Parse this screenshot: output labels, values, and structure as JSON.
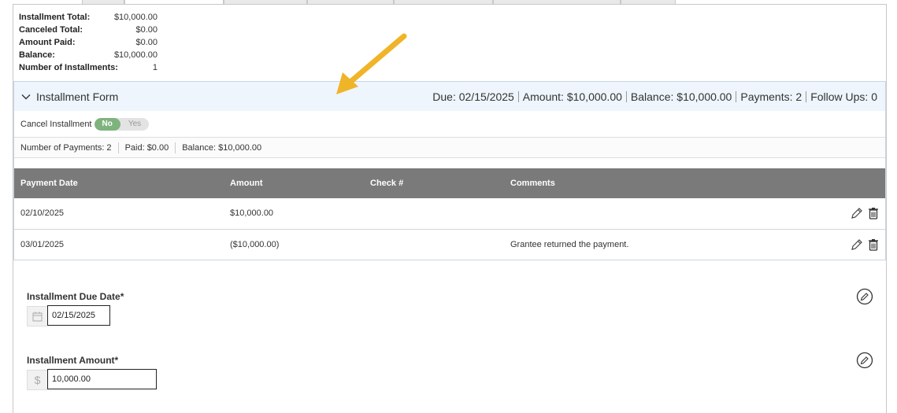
{
  "summary": {
    "rows": [
      {
        "label": "Installment Total:",
        "value": "$10,000.00"
      },
      {
        "label": "Canceled Total:",
        "value": "$0.00"
      },
      {
        "label": "Amount Paid:",
        "value": "$0.00"
      },
      {
        "label": "Balance:",
        "value": "$10,000.00"
      },
      {
        "label": "Number of Installments:",
        "value": "1"
      }
    ]
  },
  "panel": {
    "title": "Installment Form",
    "due": "Due: 02/15/2025",
    "amount": "Amount: $10,000.00",
    "balance": "Balance: $10,000.00",
    "payments": "Payments: 2",
    "followups": "Follow Ups: 0"
  },
  "cancel": {
    "label": "Cancel Installment",
    "no": "No",
    "yes": "Yes"
  },
  "counts": {
    "payments": "Number of Payments: 2",
    "paid": "Paid: $0.00",
    "balance": "Balance: $10,000.00"
  },
  "table": {
    "headers": [
      "Payment Date",
      "Amount",
      "Check #",
      "Comments"
    ],
    "rows": [
      {
        "date": "02/10/2025",
        "amount": "$10,000.00",
        "check": "",
        "comment": ""
      },
      {
        "date": "03/01/2025",
        "amount": "($10,000.00)",
        "check": "",
        "comment": "Grantee returned the payment."
      }
    ]
  },
  "form": {
    "due_label": "Installment Due Date*",
    "due_value": "02/15/2025",
    "amount_label": "Installment Amount*",
    "amount_value": "10,000.00",
    "currency_symbol": "$"
  },
  "colors": {
    "accent_toggle": "#7fb37e",
    "table_header": "#7a7a7a",
    "panel_header_bg": "#eef5fc",
    "arrow": "#f0b428"
  }
}
